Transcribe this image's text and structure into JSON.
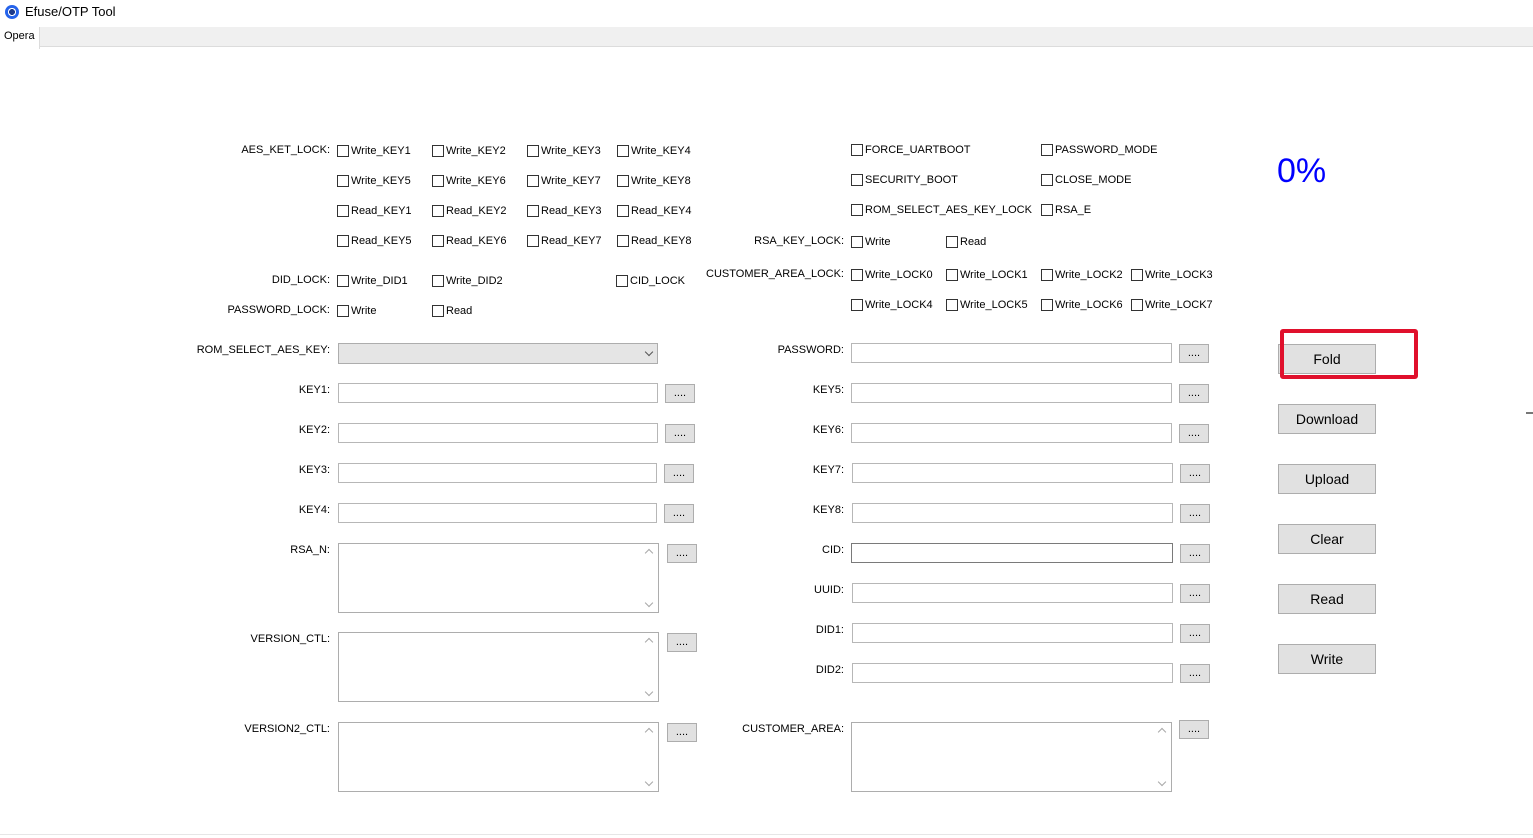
{
  "window": {
    "title": "Efuse/OTP Tool"
  },
  "menu": {
    "tab": "Opera"
  },
  "left": {
    "aes_label": "AES_KET_LOCK:",
    "aes": [
      "Write_KEY1",
      "Write_KEY2",
      "Write_KEY3",
      "Write_KEY4",
      "Write_KEY5",
      "Write_KEY6",
      "Write_KEY7",
      "Write_KEY8",
      "Read_KEY1",
      "Read_KEY2",
      "Read_KEY3",
      "Read_KEY4",
      "Read_KEY5",
      "Read_KEY6",
      "Read_KEY7",
      "Read_KEY8"
    ],
    "did_label": "DID_LOCK:",
    "did": [
      "Write_DID1",
      "Write_DID2"
    ],
    "cid_lock": "CID_LOCK",
    "pwd_label": "PASSWORD_LOCK:",
    "pwd": [
      "Write",
      "Read"
    ],
    "rom_label": "ROM_SELECT_AES_KEY:",
    "key1": "KEY1:",
    "key2": "KEY2:",
    "key3": "KEY3:",
    "key4": "KEY4:",
    "rsa_n": "RSA_N:",
    "version_ctl": "VERSION_CTL:",
    "version2_ctl": "VERSION2_CTL:"
  },
  "right": {
    "flags": [
      "FORCE_UARTBOOT",
      "PASSWORD_MODE",
      "SECURITY_BOOT",
      "CLOSE_MODE",
      "ROM_SELECT_AES_KEY_LOCK",
      "RSA_E"
    ],
    "rsa_lock_label": "RSA_KEY_LOCK:",
    "rsa_lock": [
      "Write",
      "Read"
    ],
    "cust_lock_label": "CUSTOMER_AREA_LOCK:",
    "cust_lock": [
      "Write_LOCK0",
      "Write_LOCK1",
      "Write_LOCK2",
      "Write_LOCK3",
      "Write_LOCK4",
      "Write_LOCK5",
      "Write_LOCK6",
      "Write_LOCK7"
    ],
    "password": "PASSWORD:",
    "key5": "KEY5:",
    "key6": "KEY6:",
    "key7": "KEY7:",
    "key8": "KEY8:",
    "cid": "CID:",
    "uuid": "UUID:",
    "did1": "DID1:",
    "did2": "DID2:",
    "customer_area": "CUSTOMER_AREA:"
  },
  "browse_label": "....",
  "progress": "0%",
  "buttons": {
    "fold": "Fold",
    "download": "Download",
    "upload": "Upload",
    "clear": "Clear",
    "read": "Read",
    "write": "Write"
  }
}
